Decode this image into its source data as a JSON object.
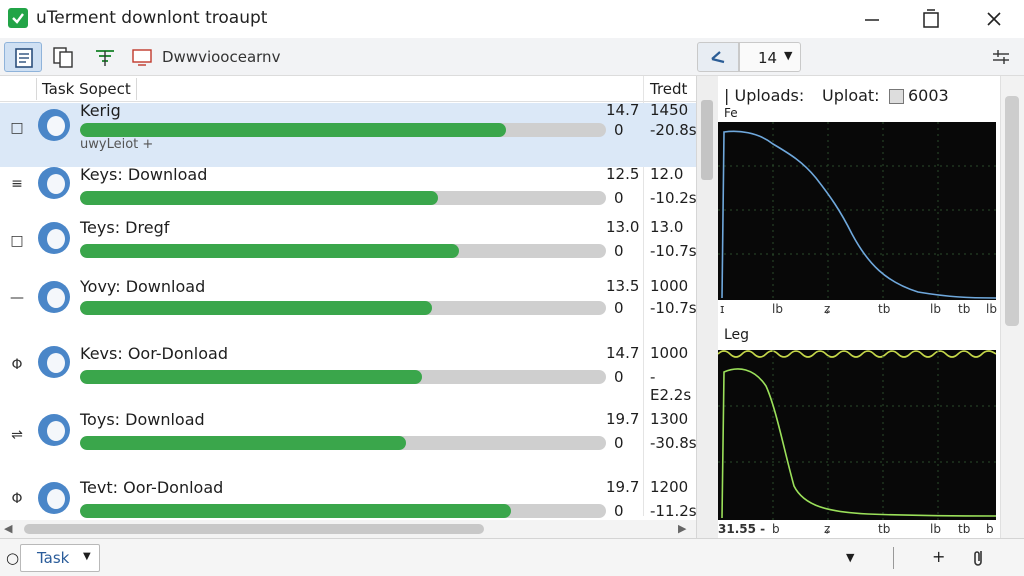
{
  "window": {
    "title": "uTerment downlont troaupt",
    "icon": "check-icon"
  },
  "toolbar": {
    "label": "Dwwvioocearnv",
    "count": "14"
  },
  "list": {
    "headers": {
      "task": "Task Sopect",
      "tredt": "Tredt"
    },
    "rows": [
      {
        "name": "Kerig",
        "sub": "uwyLeiot +",
        "size": "14.7",
        "zero": "0",
        "up": "1450",
        "eta": "-20.8s",
        "progress": 0.81,
        "side": "□"
      },
      {
        "name": "Keys: Download",
        "sub": "",
        "size": "12.5",
        "zero": "0",
        "up": "12.0",
        "eta": "-10.2s",
        "progress": 0.68,
        "side": "≡"
      },
      {
        "name": "Teys: Dregf",
        "sub": "",
        "size": "13.0",
        "zero": "0",
        "up": "13.0",
        "eta": "-10.7s",
        "progress": 0.72,
        "side": "□"
      },
      {
        "name": "Yovy: Download",
        "sub": "",
        "size": "13.5",
        "zero": "0",
        "up": "1000",
        "eta": "-10.7s",
        "progress": 0.67,
        "side": "—"
      },
      {
        "name": "Kevs: Oor-Donload",
        "sub": "",
        "size": "14.7",
        "zero": "0",
        "up": "1000",
        "eta": "-E2.2s",
        "progress": 0.65,
        "side": "Φ"
      },
      {
        "name": "Toys: Download",
        "sub": "",
        "size": "19.7",
        "zero": "0",
        "up": "1300",
        "eta": "-30.8s",
        "progress": 0.62,
        "side": "⇌"
      },
      {
        "name": "Tevt: Oor-Donload",
        "sub": "",
        "size": "19.7",
        "zero": "0",
        "up": "1200",
        "eta": "-11.2s",
        "progress": 0.82,
        "side": "Φ"
      }
    ]
  },
  "panel": {
    "upload_label": "| Uploads:",
    "upload_label2": "Uploat:",
    "upload_value": "6003",
    "sub_label": "Fe",
    "leg_label": "Leg",
    "ticks1": [
      "ɪ",
      "lb",
      "ʑ",
      "tb",
      "lb",
      "tb",
      "lb"
    ],
    "ticks2": [
      "31.55 -",
      "b",
      "ʑ",
      "tb",
      "lb",
      "tb",
      "b"
    ],
    "chart1_color": "#6fa8dc",
    "chart2_color": "#9be05a"
  },
  "bottom": {
    "task_label": "Task"
  }
}
